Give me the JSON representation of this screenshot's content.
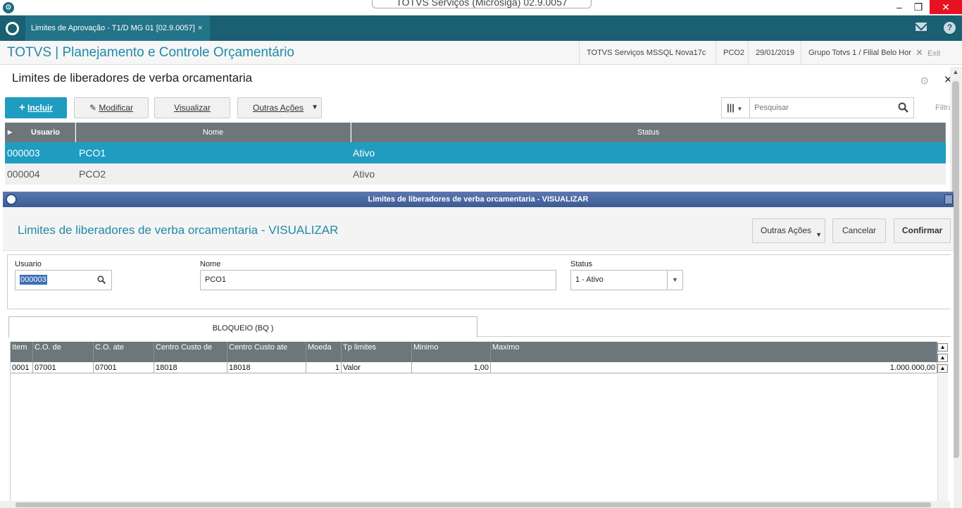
{
  "window": {
    "title": "TOTVS Serviços (Microsiga) 02.9.0057",
    "minimize": "–",
    "maximize": "❐",
    "close": "✕"
  },
  "tab": {
    "label": "Limites de Aprovação - T1/D MG 01  [02.9.0057]",
    "close": "×"
  },
  "header": {
    "app_title": "TOTVS | Planejamento e Controle Orçamentário",
    "env": "TOTVS Serviços MSSQL Nova17c",
    "module": "PCO2",
    "date": "29/01/2019",
    "company": "Grupo Totvs 1 / Filial Belo Hor",
    "exit": "Exit"
  },
  "page": {
    "title": "Limites de liberadores de verba orcamentaria",
    "buttons": {
      "include": "Incluir",
      "modify": "Modificar",
      "view": "Visualizar",
      "other": "Outras Ações"
    },
    "search_placeholder": "Pesquisar",
    "filter": "Filtra"
  },
  "browse": {
    "columns": [
      "Usuario",
      "Nome",
      "Status"
    ],
    "rows": [
      {
        "usuario": "000003",
        "nome": "PCO1",
        "status": "Ativo"
      },
      {
        "usuario": "000004",
        "nome": "PCO2",
        "status": "Ativo"
      }
    ]
  },
  "dialog": {
    "bar_title": "Limites de liberadores de verba orcamentaria - VISUALIZAR",
    "title": "Limites de liberadores de verba orcamentaria - VISUALIZAR",
    "buttons": {
      "other": "Outras Ações",
      "cancel": "Cancelar",
      "confirm": "Confirmar"
    },
    "form": {
      "usuario_label": "Usuario",
      "usuario_value": "000003",
      "nome_label": "Nome",
      "nome_value": "PCO1",
      "status_label": "Status",
      "status_value": "1 - Ativo"
    },
    "tab_label": "BLOQUEIO (BQ )",
    "items": {
      "columns": [
        "Item",
        "C.O. de",
        "C.O. ate",
        "Centro Custo de",
        "Centro Custo ate",
        "Moeda",
        "Tp limites",
        "Minimo",
        "Maximo"
      ],
      "rows": [
        {
          "item": "0001",
          "co_de": "07001",
          "co_ate": "07001",
          "cc_de": "18018",
          "cc_ate": "18018",
          "moeda": "1",
          "tp": "Valor",
          "minimo": "1,00",
          "maximo": "1.000.000,00"
        }
      ]
    }
  },
  "colors": {
    "accent": "#1f9cc0",
    "tabbar": "#1a5f72",
    "grid_header": "#6d777b",
    "dialog_bar": "#3c5a94"
  }
}
